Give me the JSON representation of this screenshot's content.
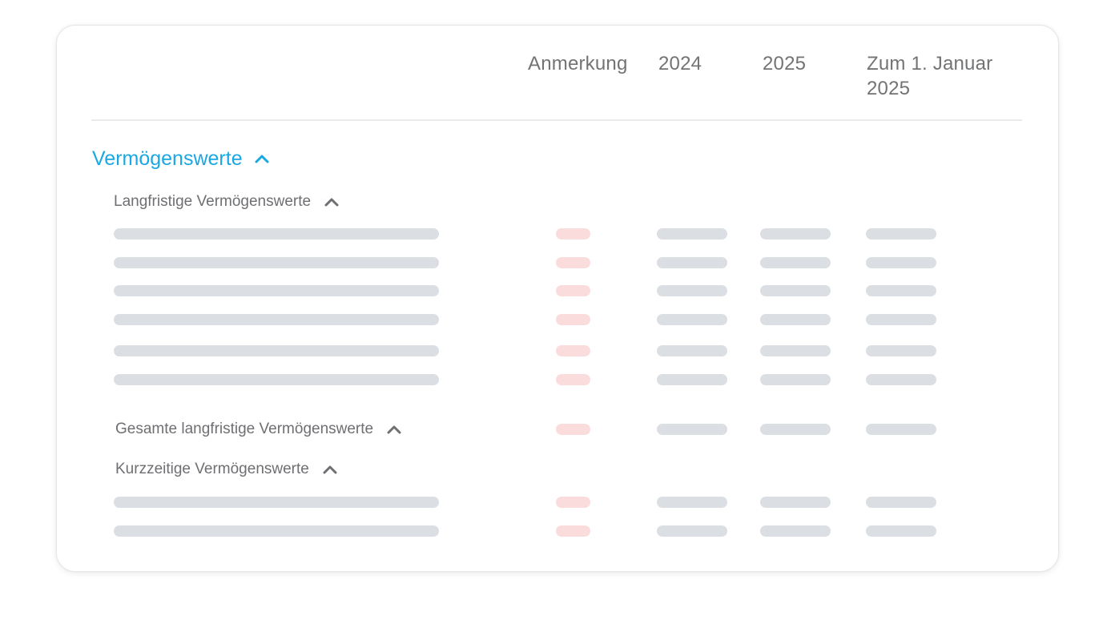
{
  "table": {
    "columns": {
      "note": "Anmerkung",
      "y2024": "2024",
      "y2025": "2025",
      "opening": "Zum 1. Januar 2025"
    }
  },
  "section": {
    "title": "Vermögenswerte",
    "accent_color": "#1aa8e2",
    "expanded": true,
    "groups": {
      "long_term": {
        "title": "Langfristige Vermögenswerte",
        "expanded": true,
        "placeholder_rows": 6
      },
      "long_term_total": {
        "title": "Gesamte langfristige Vermögenswerte",
        "expanded": true
      },
      "short_term": {
        "title": "Kurzzeitige Vermögenswerte",
        "expanded": true,
        "placeholder_rows": 2
      }
    }
  },
  "colors": {
    "placeholder_bar": "#dbdee3",
    "note_placeholder_bar": "#fbdcdc"
  },
  "icons": {
    "expand_state": "chevron-up-icon"
  }
}
